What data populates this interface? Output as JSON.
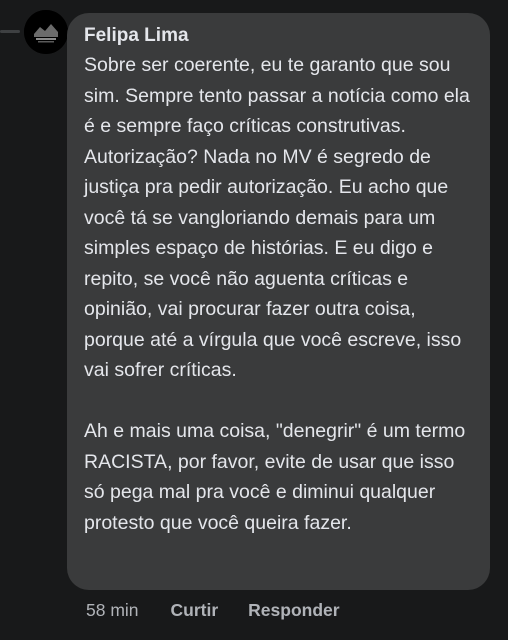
{
  "comment": {
    "author": "Felipa Lima",
    "paragraphs": [
      "Sobre ser coerente, eu te garanto que sou sim. Sempre tento passar a notícia como ela é e sempre faço críticas construtivas. Autorização? Nada no MV é segredo de justiça pra pedir autorização. Eu acho que você tá se vangloriando demais para um simples espaço de histórias. E eu digo e repito, se você não aguenta críticas e opinião, vai procurar fazer outra coisa, porque até a vírgula que você escreve, isso vai sofrer críticas.",
      "Ah e mais uma coisa, \"denegrir\" é um termo RACISTA, por favor, evite de usar que isso só pega mal pra você e diminui qualquer protesto que você queira fazer."
    ]
  },
  "actions": {
    "timestamp": "58 min",
    "like_label": "Curtir",
    "reply_label": "Responder"
  },
  "colors": {
    "background": "#18191a",
    "bubble": "#3a3b3c",
    "text": "#e4e6eb",
    "secondary_text": "#b0b3b8"
  }
}
